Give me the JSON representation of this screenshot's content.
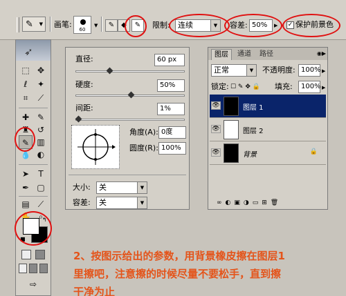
{
  "options_bar": {
    "brush_label": "画笔:",
    "brush_size": "60",
    "limits_label": "限制:",
    "limits_value": "连续",
    "tolerance_label": "容差:",
    "tolerance_value": "50%",
    "protect_fg_label": "保护前景色",
    "protect_fg_checked": "✓"
  },
  "brush_panel": {
    "diameter_label": "直径:",
    "diameter_value": "60 px",
    "hardness_label": "硬度:",
    "hardness_value": "50%",
    "spacing_label": "间距:",
    "spacing_value": "1%",
    "angle_label": "角度(A):",
    "angle_value": "0度",
    "roundness_label": "圆度(R):",
    "roundness_value": "100%",
    "size_label": "大小:",
    "size_value": "关",
    "tolerance_label": "容差:",
    "tolerance_value": "关"
  },
  "layers_panel": {
    "tabs": [
      "图层",
      "通道",
      "路径"
    ],
    "blend_mode": "正常",
    "opacity_label": "不透明度:",
    "opacity_value": "100%",
    "lock_label": "锁定:",
    "fill_label": "填充:",
    "fill_value": "100%",
    "layers": [
      {
        "name": "图层 1",
        "selected": true
      },
      {
        "name": "图层 2",
        "selected": false
      },
      {
        "name": "背景",
        "selected": false
      }
    ]
  },
  "instruction": {
    "line1": "2、按图示给出的参数，用背景橡皮擦在图层1",
    "line2": "里擦吧，注意擦的时候尽量不要松手，直到擦",
    "line3": "干净为止"
  },
  "colors": {
    "annotation_red": "#e01010",
    "instruction_orange": "#e4541a",
    "selection_blue": "#0a246a"
  }
}
